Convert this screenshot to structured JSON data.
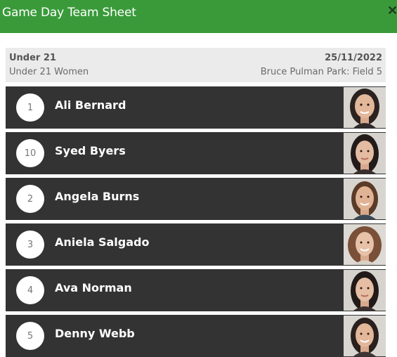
{
  "header": {
    "title": "Game Day Team Sheet",
    "close_symbol": "✕",
    "background_color": "#3a9a3a"
  },
  "match": {
    "division": "Under 21",
    "grade": "Under 21 Women",
    "date": "25/11/2022",
    "venue": "Bruce Pulman Park: Field 5"
  },
  "players": [
    {
      "number": "1",
      "name": "Ali Bernard",
      "photo_icon": "player-photo"
    },
    {
      "number": "10",
      "name": "Syed Byers",
      "photo_icon": "player-photo"
    },
    {
      "number": "2",
      "name": "Angela Burns",
      "photo_icon": "player-photo"
    },
    {
      "number": "3",
      "name": "Aniela Salgado",
      "photo_icon": "player-photo"
    },
    {
      "number": "4",
      "name": "Ava Norman",
      "photo_icon": "player-photo"
    },
    {
      "number": "5",
      "name": "Denny Webb",
      "photo_icon": "player-photo"
    }
  ],
  "colors": {
    "row_background": "#333333",
    "info_background": "#ebebeb"
  }
}
